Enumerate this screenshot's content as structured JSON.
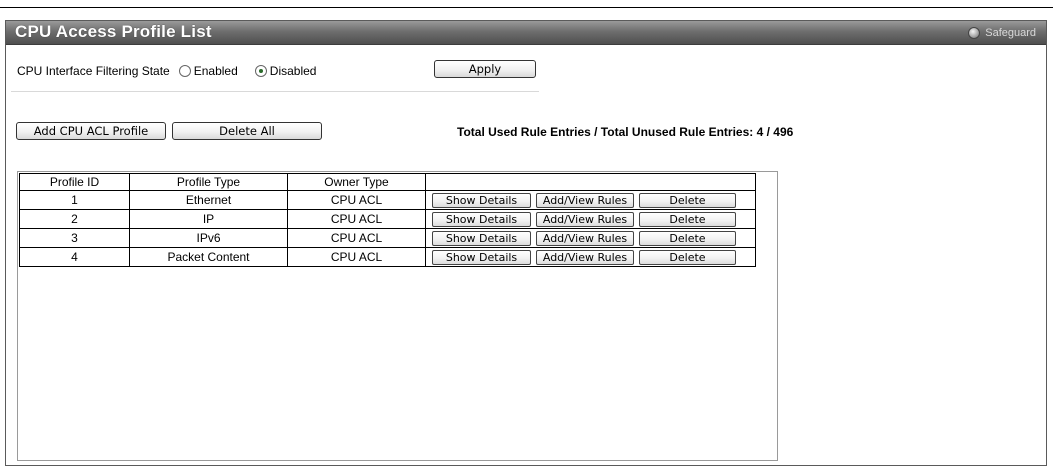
{
  "page": {
    "title": "CPU Access Profile List",
    "safeguard_label": "Safeguard"
  },
  "filtering": {
    "label": "CPU Interface Filtering State",
    "options": [
      "Enabled",
      "Disabled"
    ],
    "selected": "Disabled",
    "apply_label": "Apply"
  },
  "actions": {
    "add_label": "Add CPU ACL Profile",
    "delete_all_label": "Delete All",
    "entries_text": "Total Used Rule Entries / Total Unused Rule Entries: 4 / 496"
  },
  "table": {
    "headers": [
      "Profile ID",
      "Profile Type",
      "Owner Type",
      ""
    ],
    "rows": [
      {
        "id": "1",
        "type": "Ethernet",
        "owner": "CPU ACL"
      },
      {
        "id": "2",
        "type": "IP",
        "owner": "CPU ACL"
      },
      {
        "id": "3",
        "type": "IPv6",
        "owner": "CPU ACL"
      },
      {
        "id": "4",
        "type": "Packet Content",
        "owner": "CPU ACL"
      }
    ],
    "row_buttons": {
      "details": "Show Details",
      "rules": "Add/View Rules",
      "delete": "Delete"
    }
  }
}
